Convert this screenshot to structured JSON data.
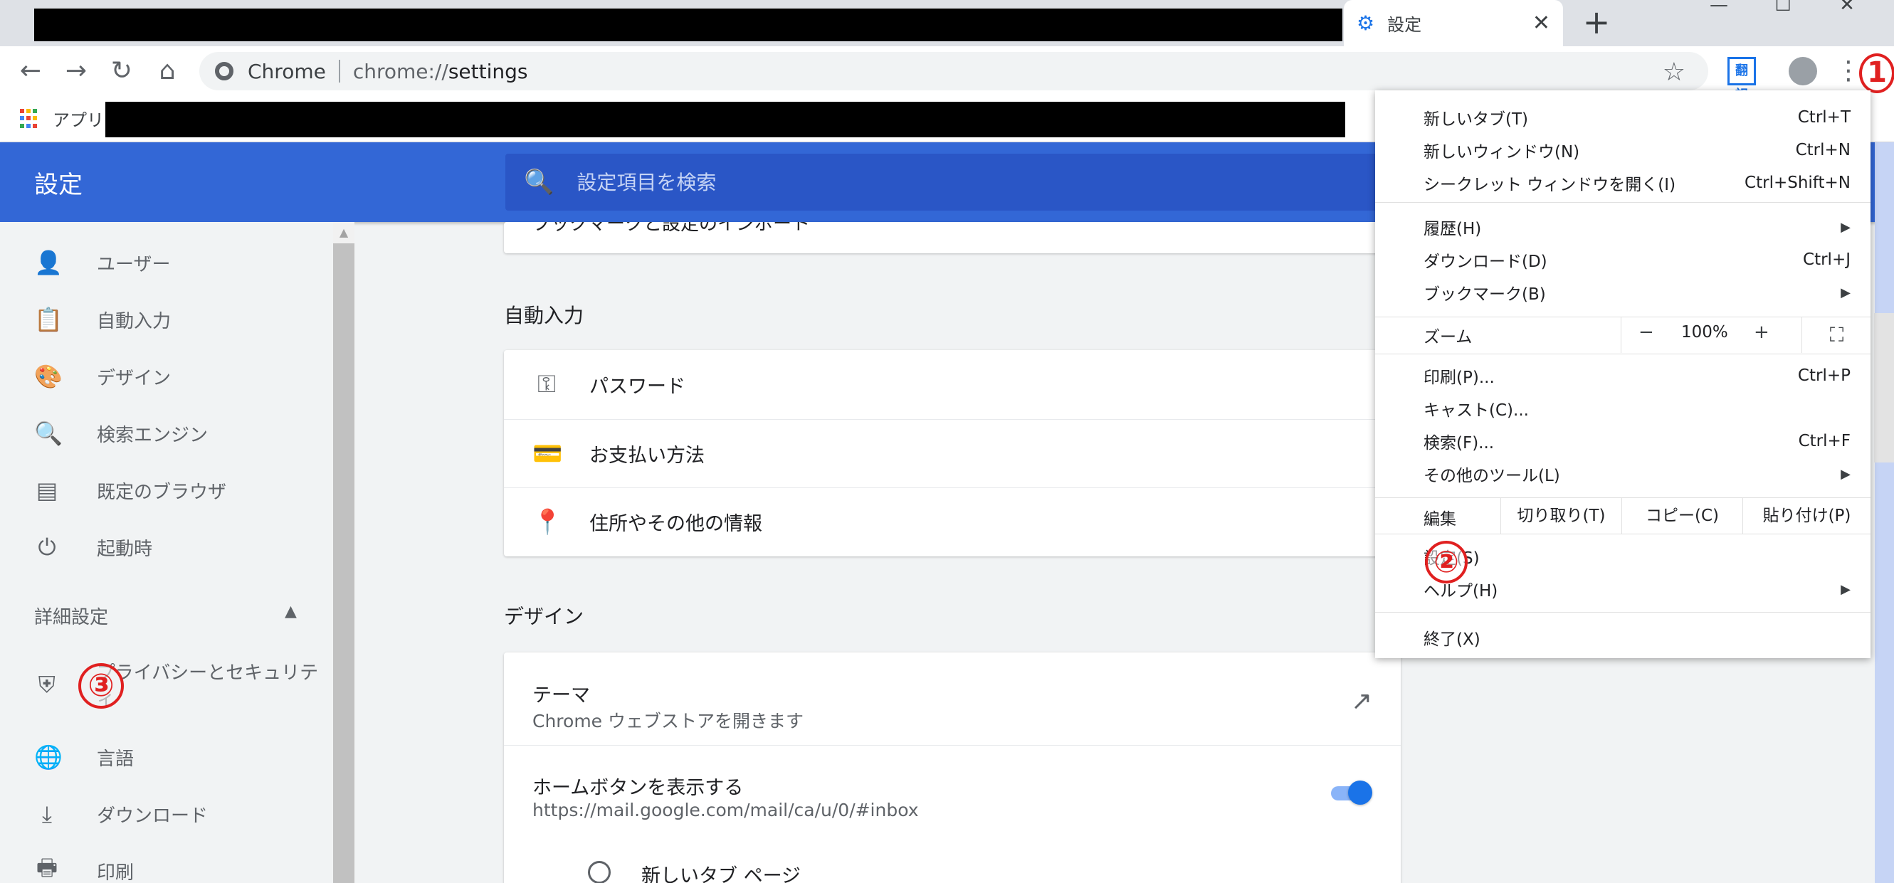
{
  "tab": {
    "title": "設定",
    "close": "✕",
    "new_tab": "+"
  },
  "window": {
    "minimize": "—",
    "maximize": "☐",
    "close": "✕"
  },
  "toolbar": {
    "back": "←",
    "forward": "→",
    "reload": "↻",
    "home": "⌂",
    "omnibox_label": "Chrome",
    "url_scheme": "chrome://",
    "url_host": "settings",
    "star": "☆",
    "extension_text": "翻訳",
    "menu": "⋮"
  },
  "bookmarks": {
    "apps_label": "アプリ"
  },
  "header": {
    "title": "設定",
    "search_placeholder": "設定項目を検索",
    "search_icon": "🔍"
  },
  "sidebar": {
    "items": [
      {
        "label": "ユーザー",
        "icon": "person-icon",
        "glyph": "👤"
      },
      {
        "label": "自動入力",
        "icon": "clipboard-icon",
        "glyph": "📋"
      },
      {
        "label": "デザイン",
        "icon": "palette-icon",
        "glyph": "🎨"
      },
      {
        "label": "検索エンジン",
        "icon": "search-icon",
        "glyph": "🔍"
      },
      {
        "label": "既定のブラウザ",
        "icon": "browser-icon",
        "glyph": "▤"
      },
      {
        "label": "起動時",
        "icon": "power-icon",
        "glyph": "⏻"
      }
    ],
    "advanced_label": "詳細設定",
    "advanced_arrow": "▲",
    "advanced_items": [
      {
        "label": "プライバシーとセキュリティ",
        "icon": "shield-icon",
        "glyph": "⛨"
      },
      {
        "label": "言語",
        "icon": "globe-icon",
        "glyph": "🌐"
      },
      {
        "label": "ダウンロード",
        "icon": "download-icon",
        "glyph": "⤓"
      },
      {
        "label": "印刷",
        "icon": "print-icon",
        "glyph": "🖶"
      }
    ]
  },
  "main": {
    "prev_card_text": "ブックマークと設定のインポート",
    "autofill_title": "自動入力",
    "autofill_rows": [
      {
        "label": "パスワード",
        "icon": "key-icon",
        "glyph": "⚿"
      },
      {
        "label": "お支払い方法",
        "icon": "credit-card-icon",
        "glyph": "💳"
      },
      {
        "label": "住所やその他の情報",
        "icon": "location-pin-icon",
        "glyph": "📍"
      }
    ],
    "design_title": "デザイン",
    "theme_title": "テーマ",
    "theme_sub": "Chrome ウェブストアを開きます",
    "external_link_glyph": "↗",
    "home_button_title": "ホームボタンを表示する",
    "home_button_url": "https://mail.google.com/mail/ca/u/0/#inbox",
    "home_button_enabled": true,
    "radio_new_tab_label": "新しいタブ ページ"
  },
  "menu": {
    "group1": [
      {
        "label": "新しいタブ(T)",
        "shortcut": "Ctrl+T"
      },
      {
        "label": "新しいウィンドウ(N)",
        "shortcut": "Ctrl+N"
      },
      {
        "label": "シークレット ウィンドウを開く(I)",
        "shortcut": "Ctrl+Shift+N"
      }
    ],
    "group2": [
      {
        "label": "履歴(H)",
        "shortcut": "",
        "submenu": "▶"
      },
      {
        "label": "ダウンロード(D)",
        "shortcut": "Ctrl+J"
      },
      {
        "label": "ブックマーク(B)",
        "shortcut": "",
        "submenu": "▶"
      }
    ],
    "zoom": {
      "label": "ズーム",
      "minus": "−",
      "value": "100%",
      "plus": "+",
      "fullscreen": "⛶"
    },
    "group3": [
      {
        "label": "印刷(P)...",
        "shortcut": "Ctrl+P"
      },
      {
        "label": "キャスト(C)...",
        "shortcut": ""
      },
      {
        "label": "検索(F)...",
        "shortcut": "Ctrl+F"
      },
      {
        "label": "その他のツール(L)",
        "shortcut": "",
        "submenu": "▶"
      }
    ],
    "edit": {
      "label": "編集",
      "cut": "切り取り(T)",
      "copy": "コピー(C)",
      "paste": "貼り付け(P)"
    },
    "group4": [
      {
        "label": "設定(S)",
        "shortcut": ""
      },
      {
        "label": "ヘルプ(H)",
        "shortcut": "",
        "submenu": "▶"
      }
    ],
    "exit": {
      "label": "終了(X)"
    }
  },
  "annotations": {
    "marker1": "1",
    "marker2": "②",
    "marker3": "③"
  },
  "colors": {
    "header_blue": "#3367d6",
    "accent_blue": "#1a73e8",
    "annotation_red": "#e02020"
  }
}
